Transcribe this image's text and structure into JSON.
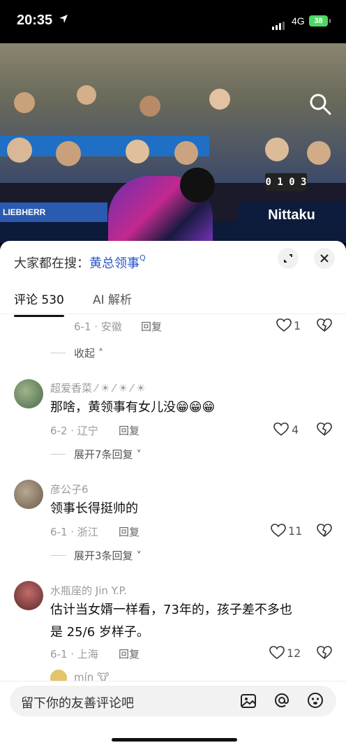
{
  "status": {
    "time": "20:35",
    "network": "4G",
    "battery": "38"
  },
  "video": {
    "board_left": "LIEBHERR",
    "board_right": "Nittaku",
    "score": "0 1 0 3"
  },
  "sheet": {
    "search_prefix": "大家都在搜：",
    "search_keyword": "黄总领事",
    "tabs": {
      "comments": "评论 530",
      "ai": "AI 解析"
    }
  },
  "comments": [
    {
      "meta": "6-1 · 安徽",
      "reply": "回复",
      "likes": "1",
      "collapse": "收起"
    },
    {
      "name": "超爱香菜 ⁄ ☀ ⁄ ☀ ⁄ ☀",
      "text": "那啥，黄领事有女儿没😁😁😁",
      "meta": "6-2 · 辽宁",
      "reply": "回复",
      "likes": "4",
      "expand": "展开7条回复"
    },
    {
      "name": "彦公子6",
      "text": "领事长得挺帅的",
      "meta": "6-1 · 浙江",
      "reply": "回复",
      "likes": "11",
      "expand": "展开3条回复"
    },
    {
      "name": "水瓶座的 Jin Y.P.",
      "text1": "估计当女婿一样看，73年的，孩子差不多也",
      "text2": "是 25/6 岁样子。",
      "meta": "6-1 · 上海",
      "reply": "回复",
      "likes": "12"
    },
    {
      "name": "mín 🐮"
    }
  ],
  "input": {
    "placeholder": "留下你的友善评论吧"
  },
  "icons": [
    "location-arrow-icon",
    "search-icon",
    "expand-icon",
    "close-icon",
    "heart-icon",
    "broken-heart-icon",
    "chevron-up-icon",
    "chevron-down-icon",
    "image-icon",
    "at-icon",
    "emoji-icon"
  ]
}
